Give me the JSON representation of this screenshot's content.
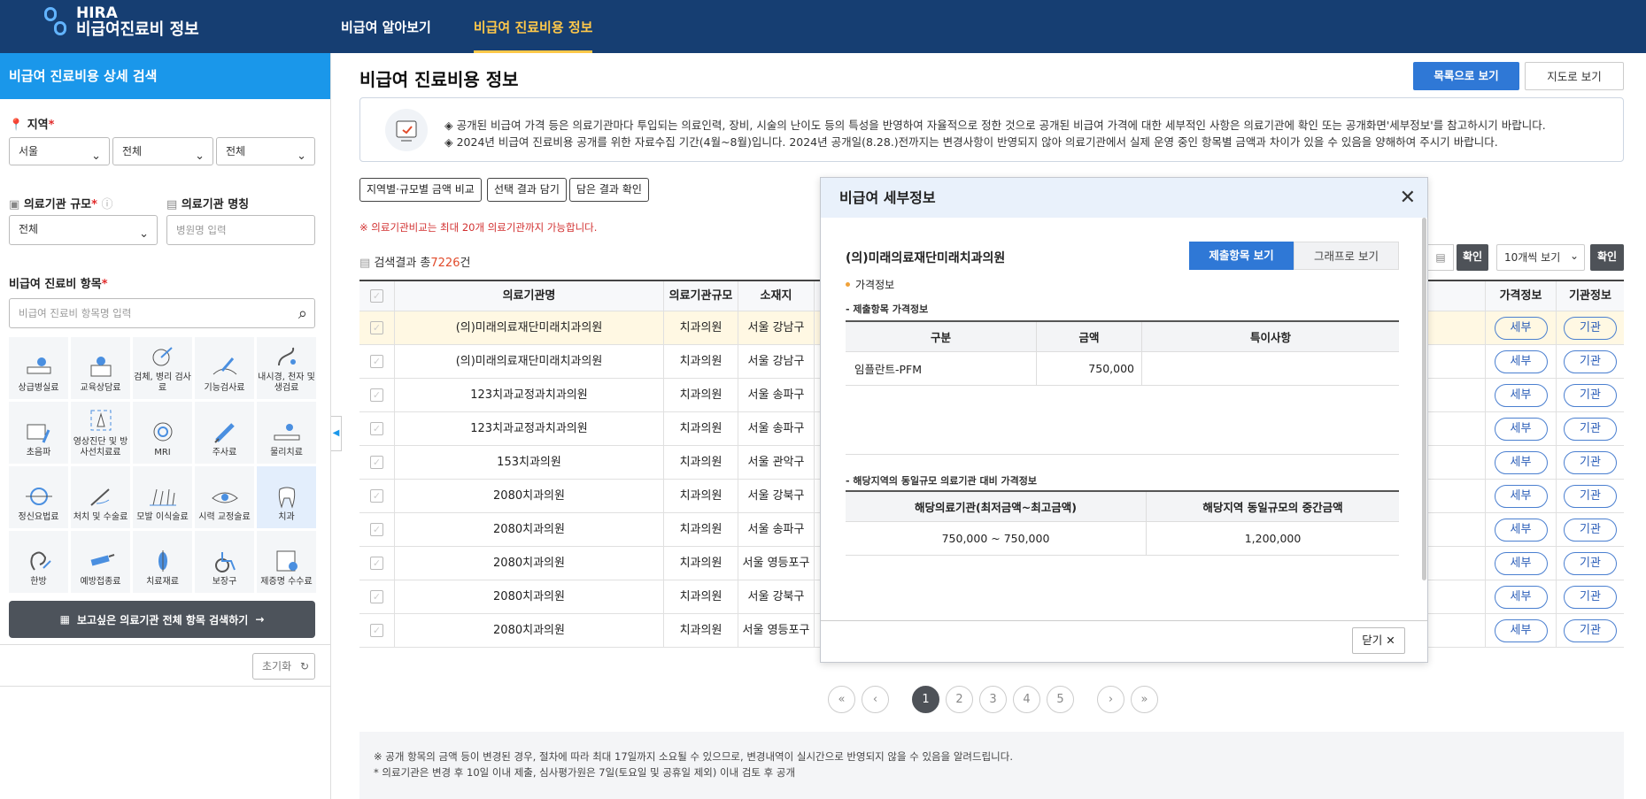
{
  "header": {
    "logo_l1": "HIRA",
    "logo_l2": "비급여진료비 정보",
    "nav": [
      "비급여 알아보기",
      "비급여 진료비용 정보"
    ]
  },
  "sidebar": {
    "title": "비급여 진료비용 상세 검색",
    "region_label": "지역",
    "region_selects": [
      "서울",
      "전체",
      "전체"
    ],
    "scale_label": "의료기관 규모",
    "scale_value": "전체",
    "name_label": "의료기관 명칭",
    "name_placeholder": "병원명 입력",
    "item_label": "비급여 진료비 항목",
    "item_placeholder": "비급여 진료비 항목명 입력",
    "categories": [
      "상급병실료",
      "교육상담료",
      "검체, 병리 검사료",
      "기능검사료",
      "내시경, 천자 및 생검료",
      "초음파",
      "영상진단 및 방사선치료료",
      "MRI",
      "주사료",
      "물리치료",
      "정신요법료",
      "처치 및 수술료",
      "모발 이식술료",
      "시력 교정술료",
      "치과",
      "한방",
      "예방접종료",
      "치료재료",
      "보장구",
      "제증명 수수료"
    ],
    "search_all": "보고싶은 의료기관 전체 항목 검색하기",
    "reset": "초기화"
  },
  "main": {
    "title": "비급여 진료비용 정보",
    "view_list": "목록으로 보기",
    "view_map": "지도로 보기",
    "notice1": "◈ 공개된 비급여 가격 등은 의료기관마다 투입되는 의료인력, 장비, 시술의 난이도 등의 특성을 반영하여 자율적으로 정한 것으로 공개된 비급여 가격에 대한 세부적인 사항은 의료기관에 확인 또는 공개화면'세부정보'를 참고하시기 바랍니다.",
    "notice2": "◈ 2024년 비급여 진료비용 공개를 위한 자료수집 기간(4월~8월)입니다. 2024년 공개일(8.28.)전까지는 변경사항이 반영되지 않아 의료기관에서 실제 운영 중인 항목별 금액과 차이가 있을 수 있음을 양해하여 주시기 바랍니다.",
    "btn_compare": "지역별·규모별 금액 비교",
    "btn_select": "선택 결과 담기",
    "btn_check": "담은 결과 확인",
    "warn": "※ 의료기관비교는 최대 20개 의료기관까지 가능합니다.",
    "count_prefix": "검색결과 총",
    "count_num": "7226",
    "count_suffix": "건",
    "confirm1": "확인",
    "per_page": "10개씩 보기",
    "confirm2": "확인",
    "columns": [
      "의료기관명",
      "의료기관규모",
      "소재지",
      "가격정보",
      "기관정보"
    ],
    "rows": [
      {
        "name": "(의)미래의료재단미래치과의원",
        "scale": "치과의원",
        "loc": "서울 강남구"
      },
      {
        "name": "(의)미래의료재단미래치과의원",
        "scale": "치과의원",
        "loc": "서울 강남구"
      },
      {
        "name": "123치과교정과치과의원",
        "scale": "치과의원",
        "loc": "서울 송파구"
      },
      {
        "name": "123치과교정과치과의원",
        "scale": "치과의원",
        "loc": "서울 송파구"
      },
      {
        "name": "153치과의원",
        "scale": "치과의원",
        "loc": "서울 관악구"
      },
      {
        "name": "2080치과의원",
        "scale": "치과의원",
        "loc": "서울 강북구"
      },
      {
        "name": "2080치과의원",
        "scale": "치과의원",
        "loc": "서울 송파구"
      },
      {
        "name": "2080치과의원",
        "scale": "치과의원",
        "loc": "서울 영등포구"
      },
      {
        "name": "2080치과의원",
        "scale": "치과의원",
        "loc": "서울 강북구"
      },
      {
        "name": "2080치과의원",
        "scale": "치과의원",
        "loc": "서울 영등포구"
      }
    ],
    "btn_detail": "세부",
    "btn_inst": "기관",
    "pages": [
      "1",
      "2",
      "3",
      "4",
      "5"
    ],
    "foot1": "※ 공개 항목의 금액 등이 변경된 경우, 절차에 따라 최대 17일까지 소요될 수 있으므로, 변경내역이 실시간으로 반영되지 않을 수 있음을 알려드립니다.",
    "foot2": "* 의료기관은 변경 후 10일 이내 제출, 심사평가원은 7일(토요일 및 공휴일 제외) 이내 검토 후 공개"
  },
  "modal": {
    "title": "비급여 세부정보",
    "inst_name": "(의)미래의료재단미래치과의원",
    "tab_submit": "제출항목 보기",
    "tab_graph": "그래프로 보기",
    "section": "가격정보",
    "sub1": "- 제출항목 가격정보",
    "t1_cols": [
      "구분",
      "금액",
      "특이사항"
    ],
    "t1_row": {
      "item": "임플란트-PFM",
      "amount": "750,000",
      "note": ""
    },
    "sub2": "- 해당지역의 동일규모 의료기관 대비 가격정보",
    "t2_cols": [
      "해당의료기관(최저금액~최고금액)",
      "해당지역 동일규모의 중간금액"
    ],
    "t2_row": {
      "range": "750,000 ~ 750,000",
      "median": "1,200,000"
    },
    "close": "닫기"
  },
  "colors": {
    "header": "#163e72",
    "accent_blue": "#1a97ea",
    "active_nav": "#ffc84a",
    "primary_btn": "#2f78d6"
  }
}
